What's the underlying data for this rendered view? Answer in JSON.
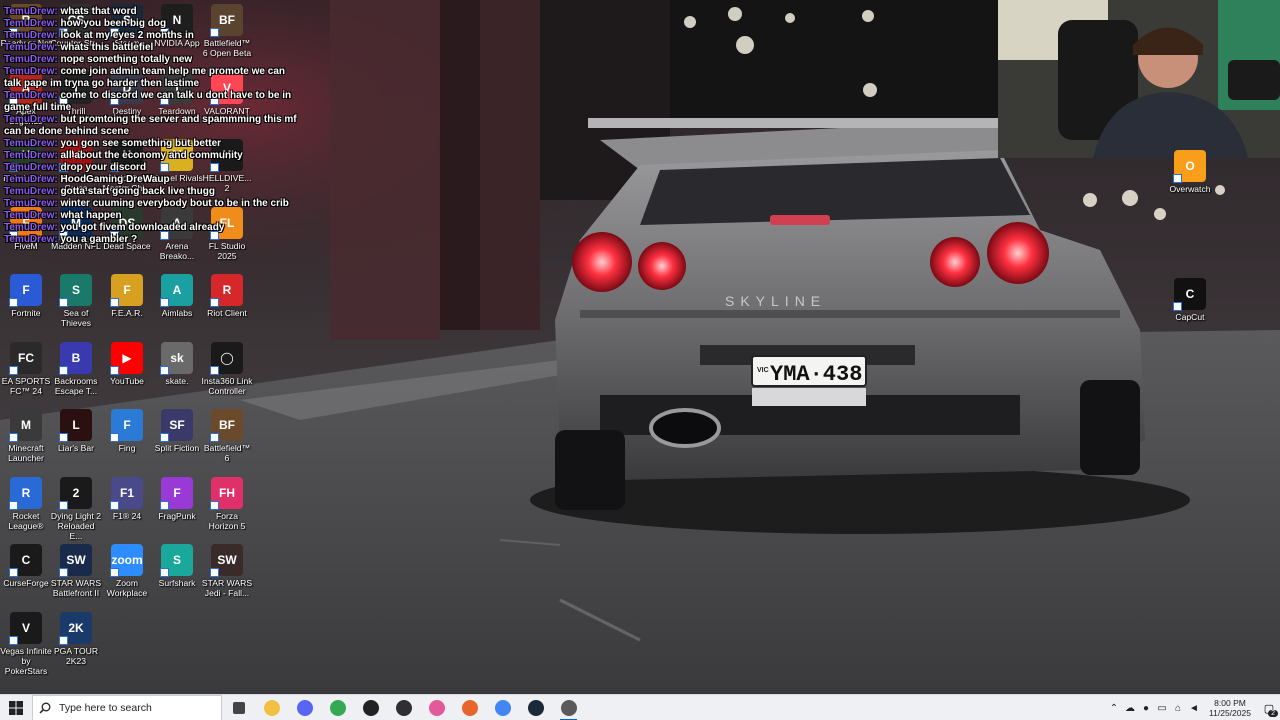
{
  "colors": {
    "chat_username": "#8a5cf0",
    "taskbar_bg": "#eef0f4",
    "accent": "#0067c0"
  },
  "desktop_icons": [
    {
      "label": "Ready or Not",
      "color": "#6b4a2a",
      "glyph": "R"
    },
    {
      "label": "Counter-Str...",
      "color": "#2f2f2f",
      "glyph": "CS"
    },
    {
      "label": "Steam",
      "color": "#1b2838",
      "glyph": "S"
    },
    {
      "label": "NVIDIA App",
      "color": "#1e1e1e",
      "glyph": "N"
    },
    {
      "label": "Battlefield™ 6 Open Beta",
      "color": "#5a4430",
      "glyph": "BF"
    },
    {
      "label": "Apex Legends",
      "color": "#b3261e",
      "glyph": "A"
    },
    {
      "label": "Thrill",
      "color": "#222222",
      "glyph": "T"
    },
    {
      "label": "Destiny",
      "color": "#3a3a4a",
      "glyph": "D"
    },
    {
      "label": "Teardown",
      "color": "#3a3a3a",
      "glyph": "T"
    },
    {
      "label": "VALORANT",
      "color": "#ff4655",
      "glyph": "V"
    },
    {
      "label": "Halo Infinite",
      "color": "#2a3a2a",
      "glyph": "H"
    },
    {
      "label": "Assetto Corsa",
      "color": "#a01010",
      "glyph": "AC"
    },
    {
      "label": "Halo The Master Chi...",
      "color": "#1a1a1a",
      "glyph": "H"
    },
    {
      "label": "Marvel Rivals",
      "color": "#d8b020",
      "glyph": "M"
    },
    {
      "label": "HELLDIVE... 2",
      "color": "#1a1a1a",
      "glyph": "H"
    },
    {
      "label": "FiveM",
      "color": "#f07818",
      "glyph": "F"
    },
    {
      "label": "Madden NFL",
      "color": "#0a2a5a",
      "glyph": "M"
    },
    {
      "label": "Dead Space",
      "color": "#2a3a2a",
      "glyph": "DS"
    },
    {
      "label": "Arena Breako...",
      "color": "#3a3a3a",
      "glyph": "A"
    },
    {
      "label": "FL Studio 2025",
      "color": "#f08c1a",
      "glyph": "FL"
    },
    {
      "label": "Fortnite",
      "color": "#2a5ad6",
      "glyph": "F"
    },
    {
      "label": "Sea of Thieves",
      "color": "#1a7a6a",
      "glyph": "S"
    },
    {
      "label": "F.E.A.R.",
      "color": "#d8a020",
      "glyph": "F"
    },
    {
      "label": "Aimlabs",
      "color": "#1aa0a0",
      "glyph": "A"
    },
    {
      "label": "Riot Client",
      "color": "#d6282a",
      "glyph": "R"
    },
    {
      "label": "EA SPORTS FC™ 24",
      "color": "#2a2a2a",
      "glyph": "FC"
    },
    {
      "label": "Backrooms Escape T...",
      "color": "#3a3ab0",
      "glyph": "B"
    },
    {
      "label": "YouTube",
      "color": "#ff0000",
      "glyph": "▶"
    },
    {
      "label": "skate.",
      "color": "#6a6a6a",
      "glyph": "sk"
    },
    {
      "label": "Insta360 Link Controller",
      "color": "#1a1a1a",
      "glyph": "◯"
    },
    {
      "label": "Minecraft Launcher",
      "color": "#3a3a3a",
      "glyph": "M"
    },
    {
      "label": "Liar's Bar",
      "color": "#2a1010",
      "glyph": "L"
    },
    {
      "label": "Fing",
      "color": "#2a7ad6",
      "glyph": "F"
    },
    {
      "label": "Split Fiction",
      "color": "#3a3a6a",
      "glyph": "SF"
    },
    {
      "label": "Battlefield™ 6",
      "color": "#6a4a2a",
      "glyph": "BF"
    },
    {
      "label": "Rocket League®",
      "color": "#2a6ad6",
      "glyph": "R"
    },
    {
      "label": "Dying Light 2 Reloaded E...",
      "color": "#1a1a1a",
      "glyph": "2"
    },
    {
      "label": "F1® 24",
      "color": "#4a4a8a",
      "glyph": "F1"
    },
    {
      "label": "FragPunk",
      "color": "#9a3ad6",
      "glyph": "F"
    },
    {
      "label": "Forza Horizon 5",
      "color": "#e0306a",
      "glyph": "FH"
    },
    {
      "label": "CurseForge",
      "color": "#1a1a1a",
      "glyph": "C"
    },
    {
      "label": "STAR WARS Battlefront II",
      "color": "#1a2a4a",
      "glyph": "SW"
    },
    {
      "label": "Zoom Workplace",
      "color": "#2d8cff",
      "glyph": "zoom"
    },
    {
      "label": "Surfshark",
      "color": "#1aa89a",
      "glyph": "S"
    },
    {
      "label": "STAR WARS Jedi - Fall...",
      "color": "#3a2a2a",
      "glyph": "SW"
    },
    {
      "label": "Vegas Infinite by PokerStars",
      "color": "#1a1a1a",
      "glyph": "V"
    },
    {
      "label": "PGA TOUR 2K23",
      "color": "#1a3a6a",
      "glyph": "2K"
    },
    {
      "label": "Overwatch",
      "color": "#f99e1a",
      "glyph": "O"
    },
    {
      "label": "CapCut",
      "color": "#111111",
      "glyph": "C"
    }
  ],
  "chat": [
    {
      "user": "TemuDrew:",
      "text": "whats that word"
    },
    {
      "user": "TemuDrew:",
      "text": "how you been big dog"
    },
    {
      "user": "TemuDrew:",
      "text": "look at my eyes 2 months in"
    },
    {
      "user": "TemuDrew:",
      "text": "whats this battlefiel"
    },
    {
      "user": "TemuDrew:",
      "text": "nope something totally new"
    },
    {
      "user": "TemuDrew:",
      "text": "come join admin team help me promote we can talk pape im tryna go harder then lastime"
    },
    {
      "user": "TemuDrew:",
      "text": "come to discord we can talk u dont have to be in game full time"
    },
    {
      "user": "TemuDrew:",
      "text": "but promtoing the server and spammming this mf can be done behind scene"
    },
    {
      "user": "TemuDrew:",
      "text": "you gon see something but better"
    },
    {
      "user": "TemuDrew:",
      "text": "all about the economy and community"
    },
    {
      "user": "TemuDrew:",
      "text": "drop your discord"
    },
    {
      "user": "TemuDrew:",
      "text": "HoodGaming DreWaup"
    },
    {
      "user": "TemuDrew:",
      "text": "gotta start going back live thugg"
    },
    {
      "user": "TemuDrew:",
      "text": "winter cuuming everybody bout to be in the crib"
    },
    {
      "user": "TemuDrew:",
      "text": "what happen"
    },
    {
      "user": "TemuDrew:",
      "text": "you got fivem downloaded already"
    },
    {
      "user": "TemuDrew:",
      "text": "you a gambler ?"
    }
  ],
  "wallpaper": {
    "plate": "YMA·438",
    "plate_prefix": "VIC",
    "badge": "SKYLINE"
  },
  "taskbar": {
    "search_placeholder": "Type here to search",
    "apps": [
      {
        "name": "task-view",
        "color": "#444444"
      },
      {
        "name": "file-explorer",
        "color": "#f0c040"
      },
      {
        "name": "discord",
        "color": "#5865f2"
      },
      {
        "name": "chrome",
        "color": "#34a853"
      },
      {
        "name": "app-dark",
        "color": "#222222"
      },
      {
        "name": "obs",
        "color": "#302e31"
      },
      {
        "name": "app-multi",
        "color": "#e35a9a"
      },
      {
        "name": "app-orange",
        "color": "#e8642a"
      },
      {
        "name": "chrome-2",
        "color": "#4285f4"
      },
      {
        "name": "steam",
        "color": "#1b2838"
      },
      {
        "name": "app-active",
        "color": "#5a5a5a"
      }
    ],
    "time": "8:00 PM",
    "date": "11/25/2025",
    "notification_count": "2"
  }
}
